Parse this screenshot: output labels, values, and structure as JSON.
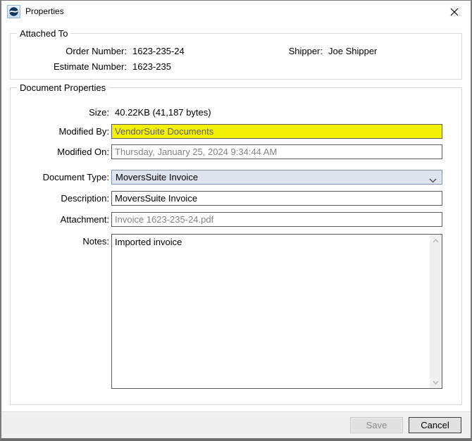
{
  "window": {
    "title": "Properties"
  },
  "attached_to": {
    "section_title": "Attached To",
    "order_number_label": "Order Number:",
    "order_number_value": "1623-235-24",
    "estimate_number_label": "Estimate Number:",
    "estimate_number_value": "1623-235",
    "shipper_label": "Shipper:",
    "shipper_value": "Joe Shipper"
  },
  "document_properties": {
    "section_title": "Document Properties",
    "size_label": "Size:",
    "size_value": "40.22KB (41,187 bytes)",
    "modified_by_label": "Modified By:",
    "modified_by_value": "VendorSuite Documents",
    "modified_on_label": "Modified On:",
    "modified_on_value": "Thursday, January 25, 2024 9:34:44 AM",
    "document_type_label": "Document Type:",
    "document_type_value": "MoversSuite Invoice",
    "description_label": "Description:",
    "description_value": "MoversSuite Invoice",
    "attachment_label": "Attachment:",
    "attachment_value": "Invoice 1623-235-24.pdf",
    "notes_label": "Notes:",
    "notes_value": "Imported invoice"
  },
  "footer": {
    "save_label": "Save",
    "cancel_label": "Cancel"
  },
  "colors": {
    "highlight_yellow": "#f5f105",
    "combobox_fill": "#dfe5ef",
    "combobox_border": "#7f93ad",
    "disabled_text": "#838383",
    "footer_bg": "#f0f0f0"
  }
}
